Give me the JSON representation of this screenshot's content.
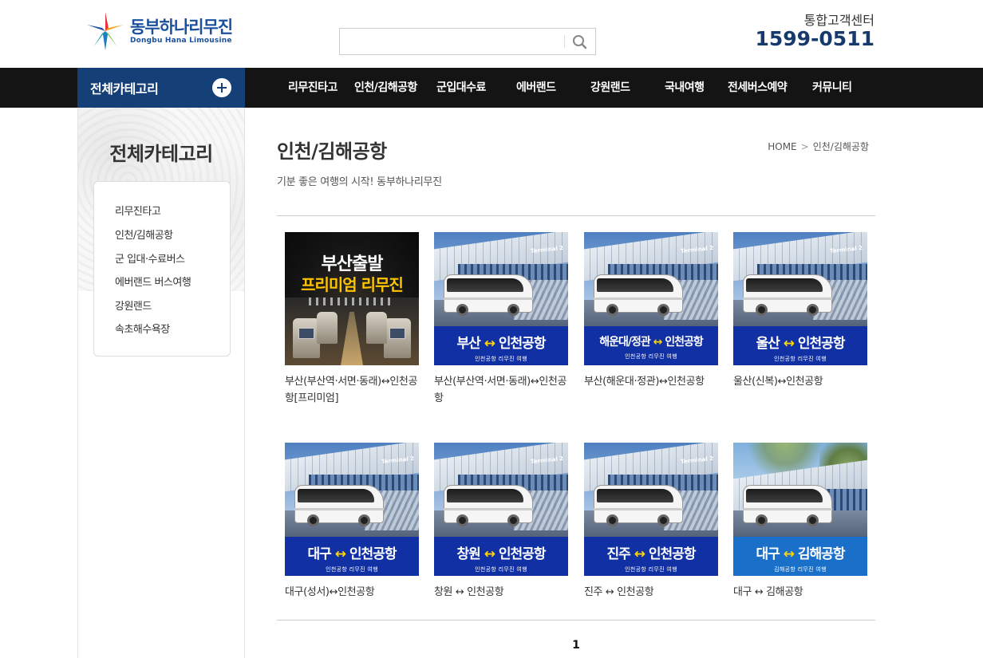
{
  "header": {
    "logo_ko": "동부하나리무진",
    "logo_en": "Dongbu Hana Limousine",
    "search_value": "",
    "cs_label": "통합고객센터",
    "cs_phone": "1599-0511"
  },
  "nav": {
    "category_button": "전체카테고리",
    "menu": [
      "리무진타고",
      "인천/김해공항",
      "군입대수료",
      "에버랜드",
      "강원랜드",
      "국내여행",
      "전세버스예약",
      "커뮤니티"
    ]
  },
  "sidebar": {
    "title": "전체카테고리",
    "items": [
      "리무진타고",
      "인천/김해공항",
      "군 입대·수료버스",
      "에버랜드 버스여행",
      "강원랜드",
      "속초해수욕장"
    ]
  },
  "main": {
    "title": "인천/김해공항",
    "subtitle": "기분 좋은 여행의 시작! 동부하나리무진",
    "breadcrumb": [
      "HOME",
      "인천/김해공항"
    ],
    "breadcrumb_sep": ">",
    "products": [
      {
        "title": "부산(부산역·서면·동래)↔인천공항[프리미엄]",
        "thumb": {
          "type": "premium",
          "line1": "부산출발",
          "line2": "프리미엄 리무진"
        }
      },
      {
        "title": "부산(부산역·서면·동래)↔인천공항",
        "thumb": {
          "type": "bus",
          "from": "부산",
          "to": "인천공항",
          "small": "인천공항 리무진 여행",
          "terminal": "Terminal 2"
        }
      },
      {
        "title": "부산(해운대·정관)↔인천공항",
        "thumb": {
          "type": "bus",
          "from": "해운대/정관",
          "to": "인천공항",
          "small": "인천공항 리무진 여행",
          "terminal": "Terminal 2"
        }
      },
      {
        "title": "울산(신복)↔인천공항",
        "thumb": {
          "type": "bus",
          "from": "울산",
          "to": "인천공항",
          "small": "인천공항 리무진 여행",
          "terminal": "Terminal 2"
        }
      },
      {
        "title": "대구(성서)↔인천공항",
        "thumb": {
          "type": "bus",
          "from": "대구",
          "to": "인천공항",
          "small": "인천공항 리무진 여행",
          "terminal": "Terminal 2"
        }
      },
      {
        "title": "창원 ↔ 인천공항",
        "thumb": {
          "type": "bus",
          "from": "창원",
          "to": "인천공항",
          "small": "인천공항 리무진 여행",
          "terminal": "Terminal 2"
        }
      },
      {
        "title": "진주 ↔ 인천공항",
        "thumb": {
          "type": "bus",
          "from": "진주",
          "to": "인천공항",
          "small": "인천공항 리무진 여행",
          "terminal": "Terminal 2"
        }
      },
      {
        "title": "대구 ↔ 김해공항",
        "thumb": {
          "type": "gimhae",
          "from": "대구",
          "to": "김해공항",
          "small": "김해공항 리무진 여행"
        }
      }
    ],
    "arrow_glyph": "↔"
  },
  "pagination": {
    "current": "1"
  },
  "colors": {
    "nav_bg": "#141414",
    "category_bg": "#153f77",
    "phone": "#163a6b",
    "banner_blue": "#1130a3",
    "banner_light": "#1a6fc9",
    "arrow_yellow": "#ffd600"
  },
  "icons": {
    "search": "search-icon",
    "plus": "plus-icon",
    "logo": "star-logo-icon"
  }
}
